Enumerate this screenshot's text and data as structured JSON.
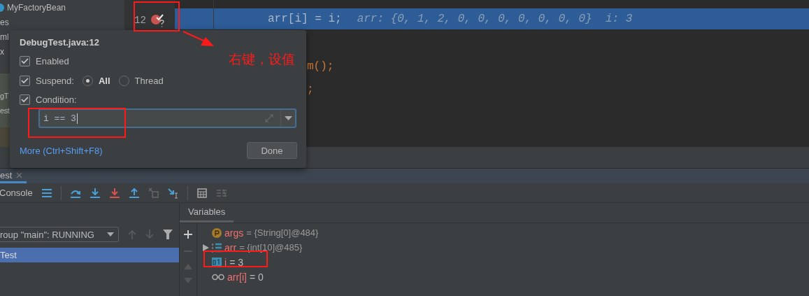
{
  "project_tree": {
    "items": [
      {
        "label": "MyFactoryBean",
        "kind": "class"
      },
      {
        "label": "es",
        "kind": "plain"
      },
      {
        "label": "ml",
        "kind": "plain"
      },
      {
        "label": "x",
        "kind": "plain"
      },
      {
        "label": "gT",
        "kind": "plain"
      },
      {
        "label": "est",
        "kind": "plain"
      }
    ]
  },
  "editor": {
    "current_line": {
      "number": "12",
      "breakpoint": true,
      "highlighted": true,
      "code": "arr[i] = i;",
      "hint": "arr: {0, 1, 2, 0, 0, 0, 0, 0, 0, 0}  i: 3"
    },
    "other_lines": [
      "m();",
      ";"
    ]
  },
  "breakpoint_popup": {
    "title": "DebugTest.java:12",
    "enabled": {
      "label": "Enabled",
      "checked": true
    },
    "suspend": {
      "label": "Suspend:",
      "checked": true,
      "options": [
        {
          "label": "All",
          "selected": true
        },
        {
          "label": "Thread",
          "selected": false
        }
      ]
    },
    "condition": {
      "label": "Condition:",
      "checked": true,
      "value": "i == 3"
    },
    "more_link": "More (Ctrl+Shift+F8)",
    "done_button": "Done"
  },
  "annotation": {
    "text": "右键，设值"
  },
  "debug_panel": {
    "tab": {
      "label": "est",
      "selected": true
    },
    "console_tab": "Console",
    "thread_dropdown": "roup \"main\": RUNNING",
    "frames": [
      {
        "label": "Test",
        "selected": true
      }
    ],
    "variables_tab": "Variables",
    "variables": [
      {
        "kind": "param",
        "name": "args",
        "value": "= {String[0]@484}",
        "expandable": false
      },
      {
        "kind": "array",
        "name": "arr",
        "value": "= {int[10]@485}",
        "expandable": true
      },
      {
        "kind": "primitive",
        "name": "i",
        "value": "= 3",
        "expandable": false
      },
      {
        "kind": "watch",
        "name": "arr[i]",
        "value": "= 0",
        "expandable": false
      }
    ]
  }
}
